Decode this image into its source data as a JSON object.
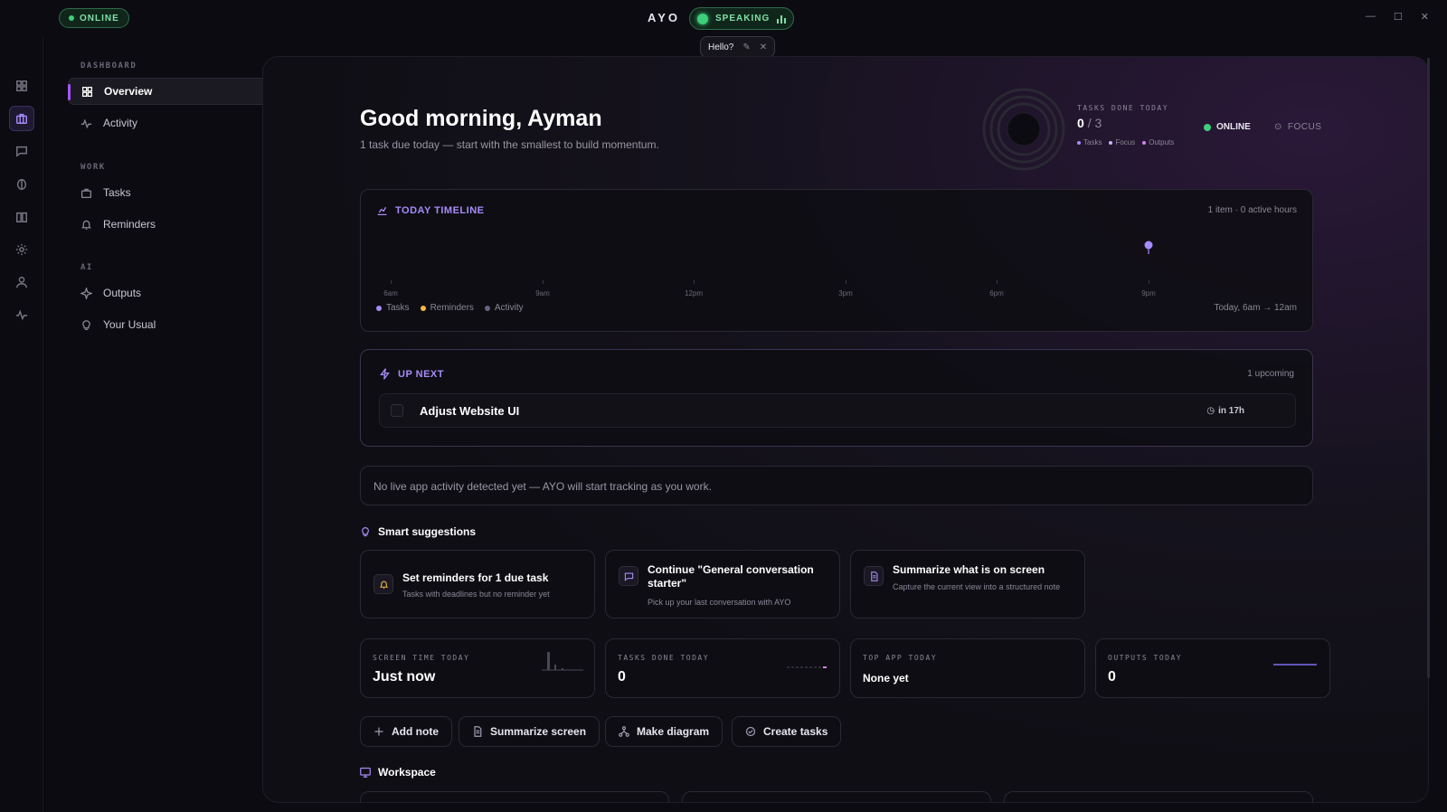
{
  "titlebar": {
    "status": "ONLINE",
    "app_name": "AYO",
    "speaking": "SPEAKING",
    "hello": "Hello?"
  },
  "sidebar": {
    "sections": [
      {
        "label": "DASHBOARD",
        "items": [
          {
            "label": "Overview",
            "icon": "grid-icon",
            "active": true
          },
          {
            "label": "Activity",
            "icon": "activity-icon"
          }
        ]
      },
      {
        "label": "WORK",
        "items": [
          {
            "label": "Tasks",
            "icon": "briefcase-icon"
          },
          {
            "label": "Reminders",
            "icon": "bell-icon"
          }
        ]
      },
      {
        "label": "AI",
        "items": [
          {
            "label": "Outputs",
            "icon": "sparkle-icon"
          },
          {
            "label": "Your Usual",
            "icon": "bulb-icon"
          }
        ]
      }
    ]
  },
  "header": {
    "greeting": "Good morning, Ayman",
    "subtitle": "1 task due today — start with the smallest to build momentum.",
    "tasks_done_label": "TASKS DONE TODAY",
    "tasks_done": "0",
    "tasks_total": "/ 3",
    "legend": [
      "Tasks",
      "Focus",
      "Outputs"
    ],
    "status": "ONLINE",
    "focus": "FOCUS"
  },
  "timeline": {
    "title": "TODAY TIMELINE",
    "meta": "1 item · 0 active hours",
    "ticks": [
      "6am",
      "9am",
      "12pm",
      "3pm",
      "6pm",
      "9pm"
    ],
    "legend": [
      "Tasks",
      "Reminders",
      "Activity"
    ],
    "range": "Today, 6am → 12am"
  },
  "upnext": {
    "title": "UP NEXT",
    "count": "1 upcoming",
    "task": "Adjust Website UI",
    "due": "in 17h"
  },
  "activity_notice": "No live app activity detected yet — AYO will start tracking as you work.",
  "suggestions": {
    "title": "Smart suggestions",
    "items": [
      {
        "title": "Set reminders for 1 due task",
        "desc": "Tasks with deadlines but no reminder yet"
      },
      {
        "title": "Continue \"General conversation starter\"",
        "desc": "Pick up your last conversation with AYO"
      },
      {
        "title": "Summarize what is on screen",
        "desc": "Capture the current view into a structured note"
      }
    ]
  },
  "stats": [
    {
      "label": "SCREEN TIME TODAY",
      "value": "Just now"
    },
    {
      "label": "TASKS DONE TODAY",
      "value": "0"
    },
    {
      "label": "TOP APP TODAY",
      "value": "None yet"
    },
    {
      "label": "OUTPUTS TODAY",
      "value": "0"
    }
  ],
  "actions": [
    "Add note",
    "Summarize screen",
    "Make diagram",
    "Create tasks"
  ],
  "workspace": {
    "title": "Workspace"
  },
  "colors": {
    "accent": "#a78bfa",
    "online": "#3ecf7a",
    "reminder": "#f5b942",
    "output": "#d880f0"
  }
}
